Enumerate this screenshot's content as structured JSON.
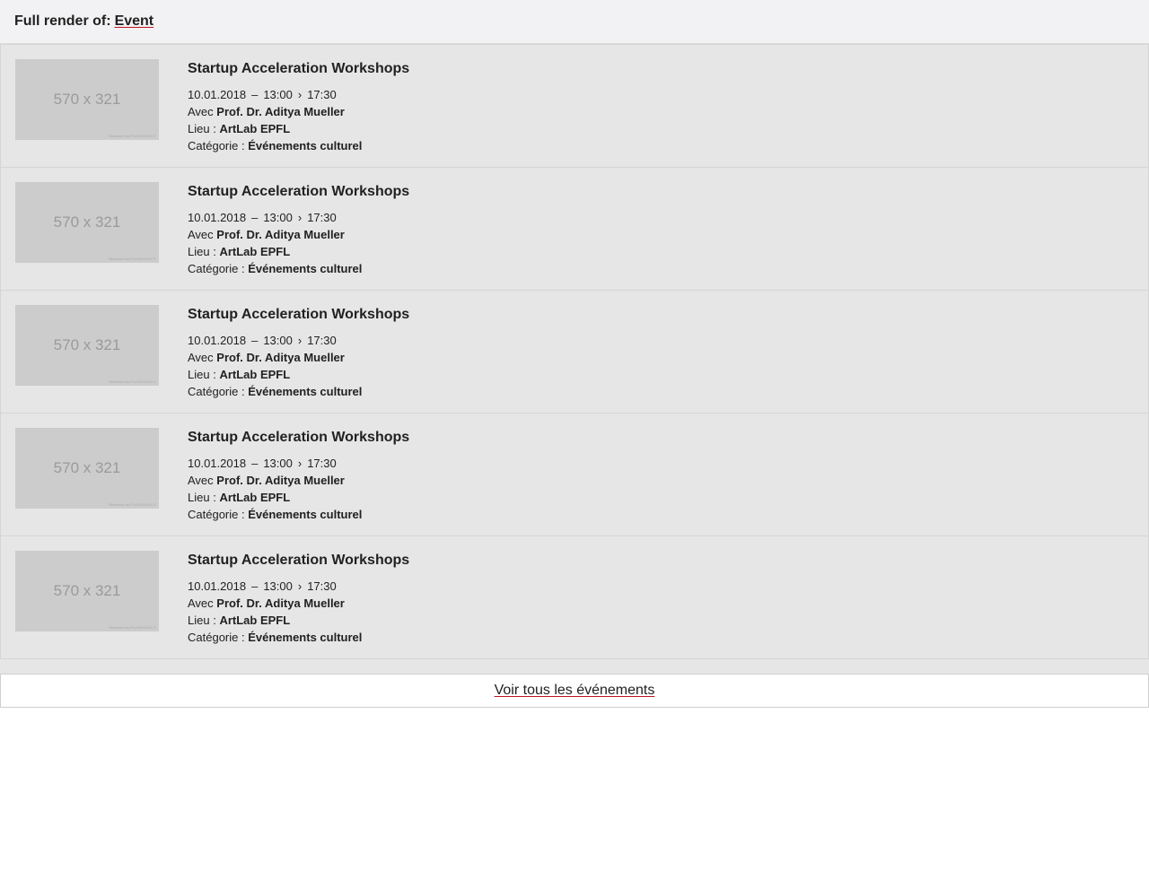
{
  "header": {
    "prefix": "Full render of:",
    "link": "Event"
  },
  "thumbnail": {
    "placeholder": "570 x 321",
    "watermark": "Rendered by PLACEHOLD.IT"
  },
  "labels": {
    "with": "Avec",
    "place": "Lieu :",
    "category": "Catégorie :",
    "dash": "–",
    "arrow": "›"
  },
  "events": [
    {
      "title": "Startup Acceleration Workshops",
      "date": "10.01.2018",
      "start": "13:00",
      "end": "17:30",
      "speaker": "Prof. Dr. Aditya Mueller",
      "place": "ArtLab EPFL",
      "category": "Événements culturel"
    },
    {
      "title": "Startup Acceleration Workshops",
      "date": "10.01.2018",
      "start": "13:00",
      "end": "17:30",
      "speaker": "Prof. Dr. Aditya Mueller",
      "place": "ArtLab EPFL",
      "category": "Événements culturel"
    },
    {
      "title": "Startup Acceleration Workshops",
      "date": "10.01.2018",
      "start": "13:00",
      "end": "17:30",
      "speaker": "Prof. Dr. Aditya Mueller",
      "place": "ArtLab EPFL",
      "category": "Événements culturel"
    },
    {
      "title": "Startup Acceleration Workshops",
      "date": "10.01.2018",
      "start": "13:00",
      "end": "17:30",
      "speaker": "Prof. Dr. Aditya Mueller",
      "place": "ArtLab EPFL",
      "category": "Événements culturel"
    },
    {
      "title": "Startup Acceleration Workshops",
      "date": "10.01.2018",
      "start": "13:00",
      "end": "17:30",
      "speaker": "Prof. Dr. Aditya Mueller",
      "place": "ArtLab EPFL",
      "category": "Événements culturel"
    }
  ],
  "footer": {
    "all_events_link": "Voir tous les événements"
  },
  "colors": {
    "link_underline": "#c1121f",
    "list_background": "#e6e6e6",
    "header_background": "#f2f2f4"
  }
}
